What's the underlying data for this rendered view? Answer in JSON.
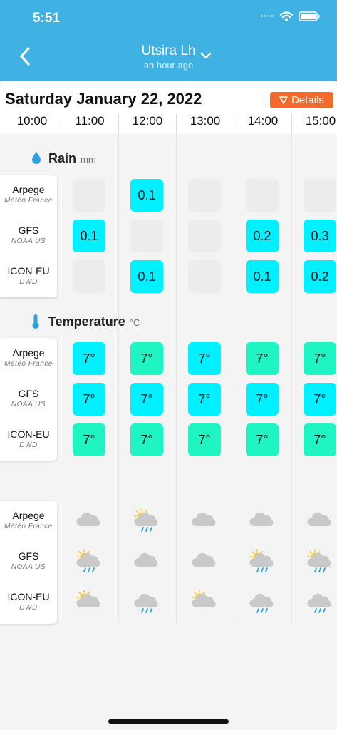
{
  "status_bar": {
    "time": "5:51"
  },
  "header": {
    "title": "Utsira Lh",
    "subtitle": "an hour ago"
  },
  "date": "Saturday January 22, 2022",
  "details_button": "Details",
  "hours": [
    "10:00",
    "11:00",
    "12:00",
    "13:00",
    "14:00",
    "15:00"
  ],
  "models": [
    {
      "name": "Arpege",
      "source": "Météo France"
    },
    {
      "name": "GFS",
      "source": "NOAA US"
    },
    {
      "name": "ICON-EU",
      "source": "DWD"
    }
  ],
  "rain": {
    "title": "Rain",
    "unit": "mm",
    "rows": [
      [
        "",
        "0.1",
        "",
        "",
        ""
      ],
      [
        "0.1",
        "",
        "",
        "0.2",
        "0.3"
      ],
      [
        "",
        "0.1",
        "",
        "0.1",
        "0.2"
      ]
    ]
  },
  "temperature": {
    "title": "Temperature",
    "unit": "°C",
    "rows": [
      [
        "7°",
        "7°",
        "7°",
        "7°",
        "7°"
      ],
      [
        "7°",
        "7°",
        "7°",
        "7°",
        "7°"
      ],
      [
        "7°",
        "7°",
        "7°",
        "7°",
        "7°"
      ]
    ],
    "colors": [
      [
        "cyan",
        "green",
        "cyan",
        "green",
        "green"
      ],
      [
        "cyan",
        "cyan",
        "cyan",
        "cyan",
        "cyan"
      ],
      [
        "green",
        "green",
        "green",
        "green",
        "green"
      ]
    ]
  },
  "weather": {
    "rows": [
      [
        "cloud-icon",
        "sun-cloud-rain-icon",
        "cloud-icon",
        "cloud-icon",
        "cloud-icon"
      ],
      [
        "sun-cloud-rain-icon",
        "cloud-icon",
        "cloud-icon",
        "sun-cloud-rain-icon",
        "sun-cloud-rain-icon"
      ],
      [
        "sun-cloud-icon",
        "cloud-rain-icon",
        "sun-cloud-icon",
        "cloud-rain-icon",
        "cloud-rain-icon"
      ]
    ]
  },
  "colors": {
    "header": "#3fb1e3",
    "details": "#f36a2b",
    "cyan": "#00f0ff",
    "green": "#1ff5c3"
  }
}
